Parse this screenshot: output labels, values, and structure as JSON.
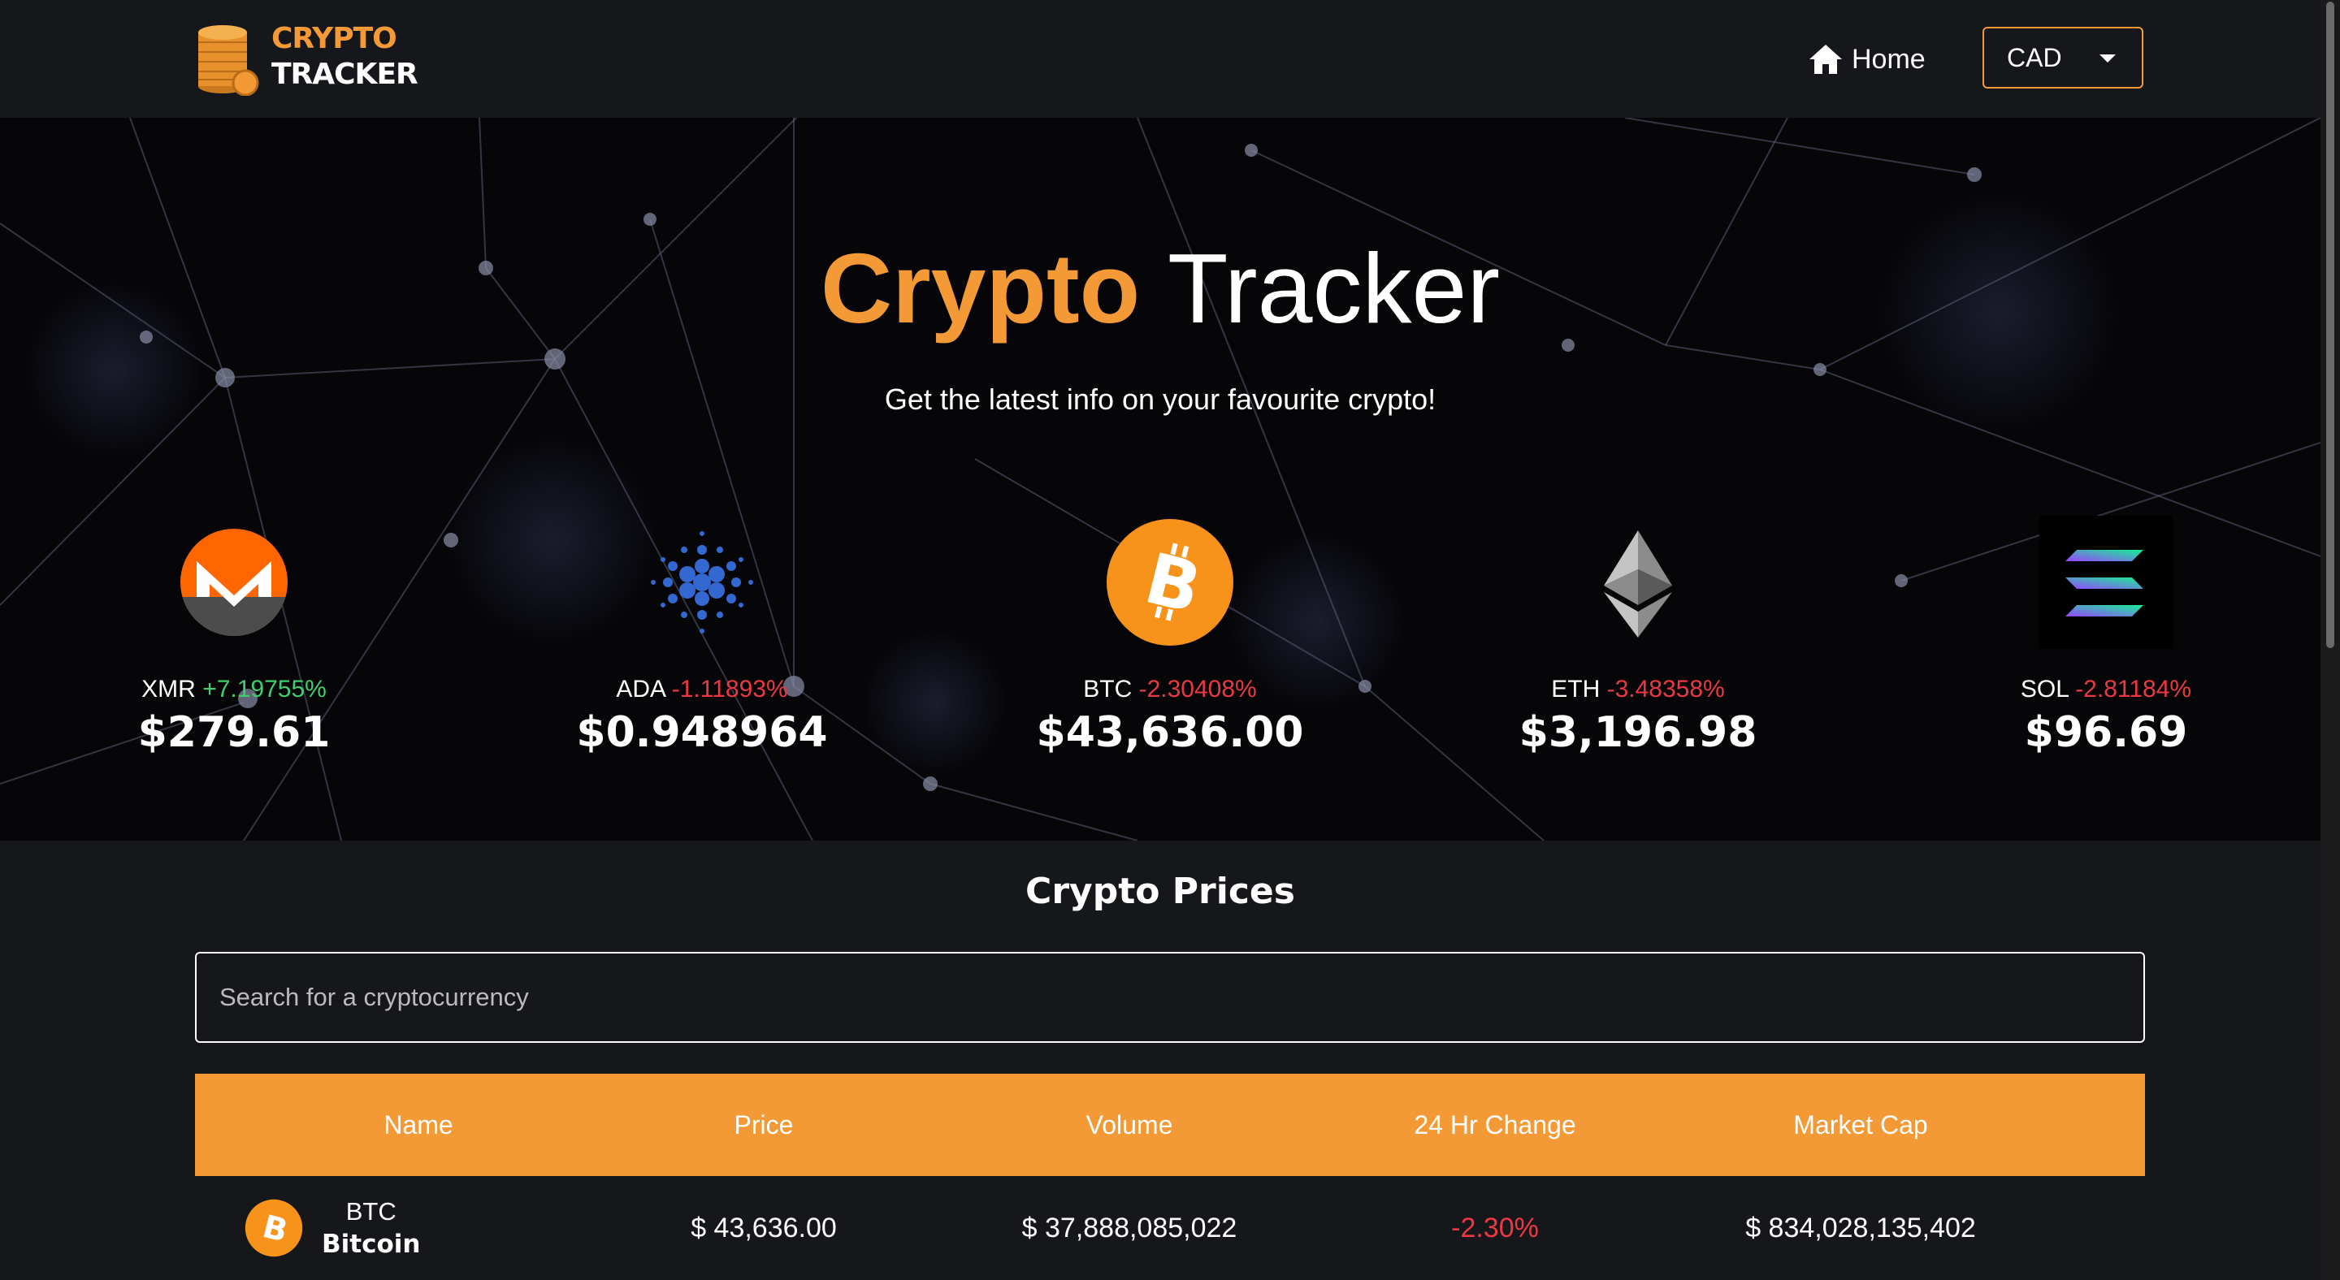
{
  "nav": {
    "logo": {
      "line1": "CRYPTO",
      "line2": "TRACKER"
    },
    "home_label": "Home",
    "currency": {
      "selected": "CAD"
    }
  },
  "hero": {
    "title_highlight": "Crypto",
    "title_rest": "Tracker",
    "subtitle": "Get the latest info on your favourite crypto!",
    "coins": [
      {
        "symbol": "XMR",
        "change": "+7.19755%",
        "direction": "up",
        "price": "$279.61",
        "icon": "monero-icon"
      },
      {
        "symbol": "ADA",
        "change": "-1.11893%",
        "direction": "down",
        "price": "$0.948964",
        "icon": "cardano-icon"
      },
      {
        "symbol": "BTC",
        "change": "-2.30408%",
        "direction": "down",
        "price": "$43,636.00",
        "icon": "bitcoin-icon"
      },
      {
        "symbol": "ETH",
        "change": "-3.48358%",
        "direction": "down",
        "price": "$3,196.98",
        "icon": "ethereum-icon"
      },
      {
        "symbol": "SOL",
        "change": "-2.81184%",
        "direction": "down",
        "price": "$96.69",
        "icon": "solana-icon"
      }
    ]
  },
  "prices": {
    "title": "Crypto Prices",
    "search_placeholder": "Search for a cryptocurrency",
    "columns": [
      "Name",
      "Price",
      "Volume",
      "24 Hr Change",
      "Market Cap"
    ],
    "rows": [
      {
        "symbol": "BTC",
        "name": "Bitcoin",
        "price": "$ 43,636.00",
        "volume": "$ 37,888,085,022",
        "change": "-2.30%",
        "market_cap": "$ 834,028,135,402",
        "icon": "bitcoin-icon"
      }
    ]
  },
  "colors": {
    "accent": "#f39a36",
    "negative": "#ea3943",
    "positive": "#3fcf6e",
    "background": "#16171a"
  }
}
